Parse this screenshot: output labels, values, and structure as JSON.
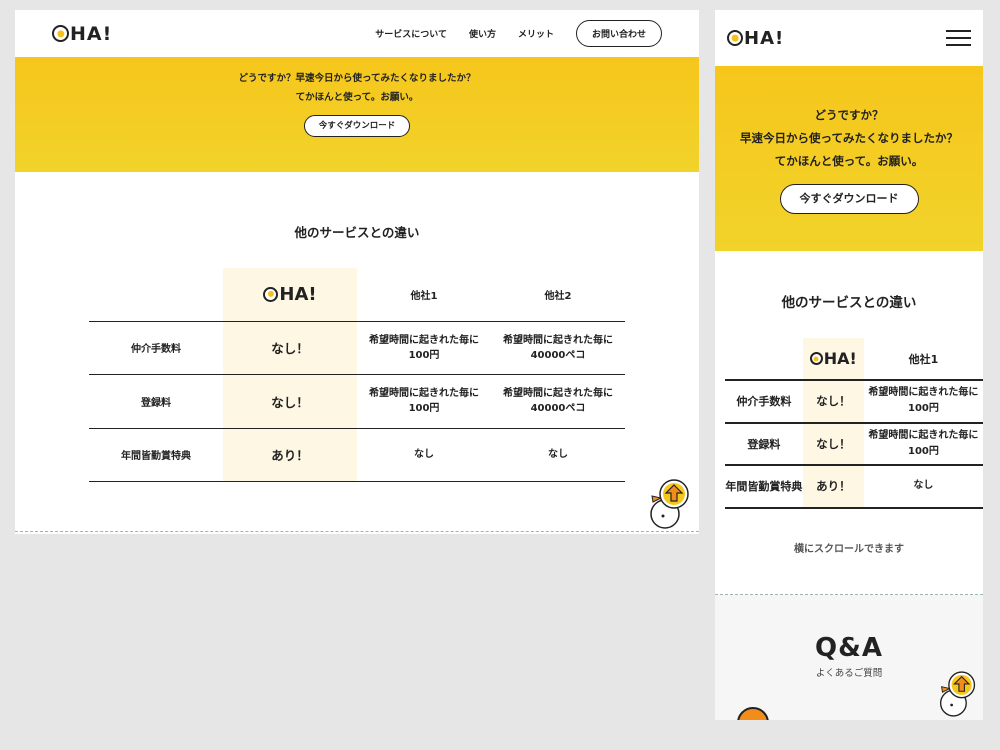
{
  "brand": {
    "logo_text": "HA!"
  },
  "nav": {
    "items": [
      "サービスについて",
      "使い方",
      "メリット"
    ],
    "contact": "お問い合わせ"
  },
  "banner": {
    "desktop_lines": [
      "どうですか？早速今日から使ってみたくなりましたか？",
      "てかほんと使って。お願い。"
    ],
    "mobile_lines": [
      "どうですか？",
      "早速今日から使ってみたくなりましたか？",
      "てかほんと使って。お願い。"
    ],
    "cta": "今すぐダウンロード"
  },
  "comparison": {
    "title": "他のサービスとの違い",
    "columns": [
      "",
      "OHA!",
      "他社1",
      "他社2"
    ],
    "rows": [
      {
        "label": "仲介手数料",
        "oha": "なし！",
        "other1": [
          "希望時間に起きれた毎に",
          "100円"
        ],
        "other2": [
          "希望時間に起きれた毎に",
          "40000ペコ"
        ]
      },
      {
        "label": "登録料",
        "oha": "なし！",
        "other1": [
          "希望時間に起きれた毎に",
          "100円"
        ],
        "other2": [
          "希望時間に起きれた毎に",
          "40000ペコ"
        ]
      },
      {
        "label": "年間皆勤賞特典",
        "oha": "あり！",
        "other1": [
          "なし"
        ],
        "other2": [
          "なし"
        ]
      }
    ],
    "scroll_note": "横にスクロールできます"
  },
  "qa": {
    "title": "Q&A",
    "subtitle": "よくあるご質問"
  },
  "colors": {
    "accent": "#f5c21b",
    "highlight": "#fdf7e3",
    "orange": "#f28d1c"
  }
}
